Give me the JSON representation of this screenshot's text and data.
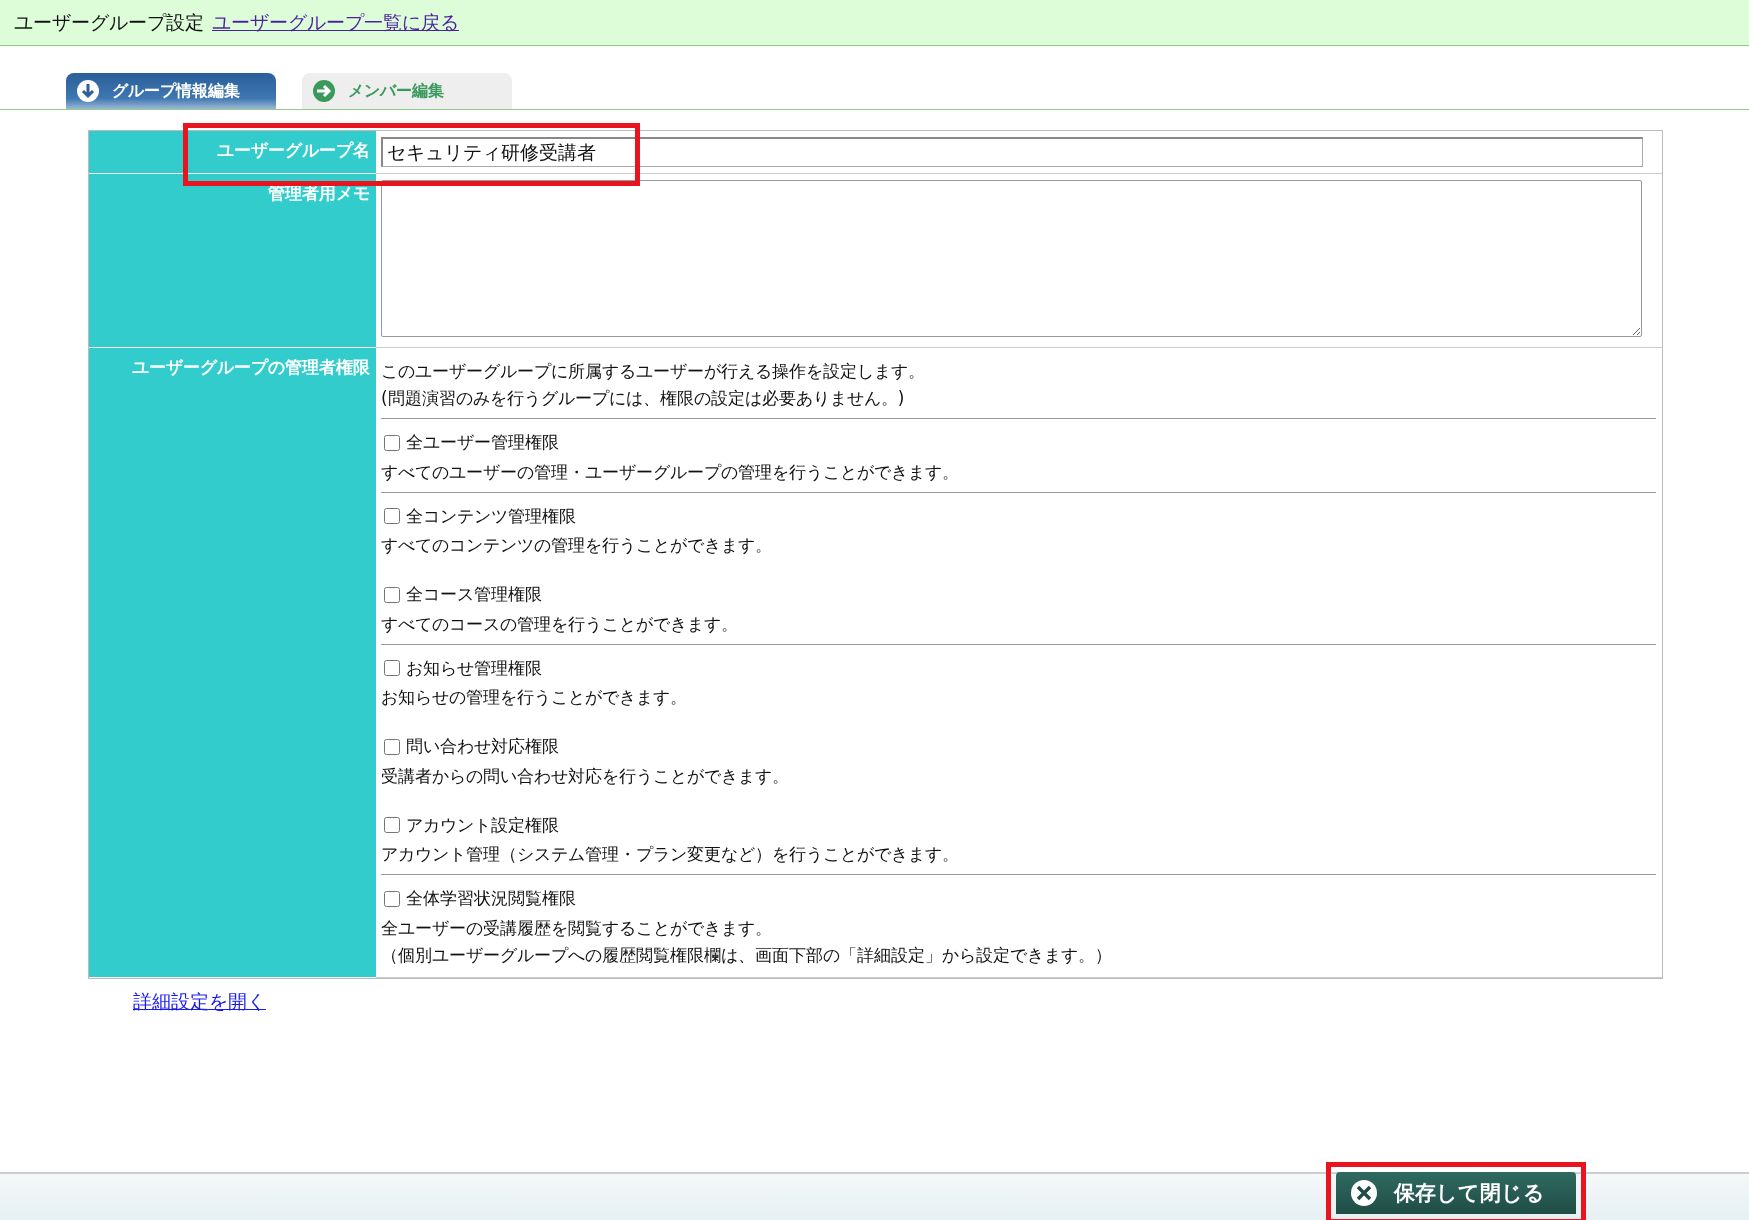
{
  "header": {
    "title": "ユーザーグループ設定",
    "back_link": "ユーザーグループ一覧に戻る"
  },
  "tabs": [
    {
      "label": "グループ情報編集",
      "selected": true
    },
    {
      "label": "メンバー編集",
      "selected": false
    }
  ],
  "form": {
    "name": {
      "label": "ユーザーグループ名",
      "value": "セキュリティ研修受講者",
      "highlighted": true
    },
    "memo": {
      "label": "管理者用メモ"
    },
    "permissions": {
      "label": "ユーザーグループの管理者権限",
      "intro": [
        "このユーザーグループに所属するユーザーが行える操作を設定します。",
        "(問題演習のみを行うグループには、権限の設定は必要ありません。)"
      ],
      "groups": [
        [
          {
            "label": "全ユーザー管理権限",
            "checked": false,
            "description": [
              "すべてのユーザーの管理・ユーザーグループの管理を行うことができます。"
            ]
          }
        ],
        [
          {
            "label": "全コンテンツ管理権限",
            "checked": false,
            "description": [
              "すべてのコンテンツの管理を行うことができます。"
            ]
          },
          {
            "label": "全コース管理権限",
            "checked": false,
            "description": [
              "すべてのコースの管理を行うことができます。"
            ]
          }
        ],
        [
          {
            "label": "お知らせ管理権限",
            "checked": false,
            "description": [
              "お知らせの管理を行うことができます。"
            ]
          },
          {
            "label": "問い合わせ対応権限",
            "checked": false,
            "description": [
              "受講者からの問い合わせ対応を行うことができます。"
            ]
          },
          {
            "label": "アカウント設定権限",
            "checked": false,
            "description": [
              "アカウント管理（システム管理・プラン変更など）を行うことができます。"
            ]
          }
        ],
        [
          {
            "label": "全体学習状況閲覧権限",
            "checked": false,
            "description": [
              "全ユーザーの受講履歴を閲覧することができます。",
              "（個別ユーザーグループへの履歴閲覧権限欄は、画面下部の「詳細設定」から設定できます。）"
            ]
          }
        ]
      ]
    }
  },
  "advanced_link": "詳細設定を開く",
  "footer": {
    "save_button": {
      "label": "保存して閉じる",
      "highlighted": true
    }
  }
}
